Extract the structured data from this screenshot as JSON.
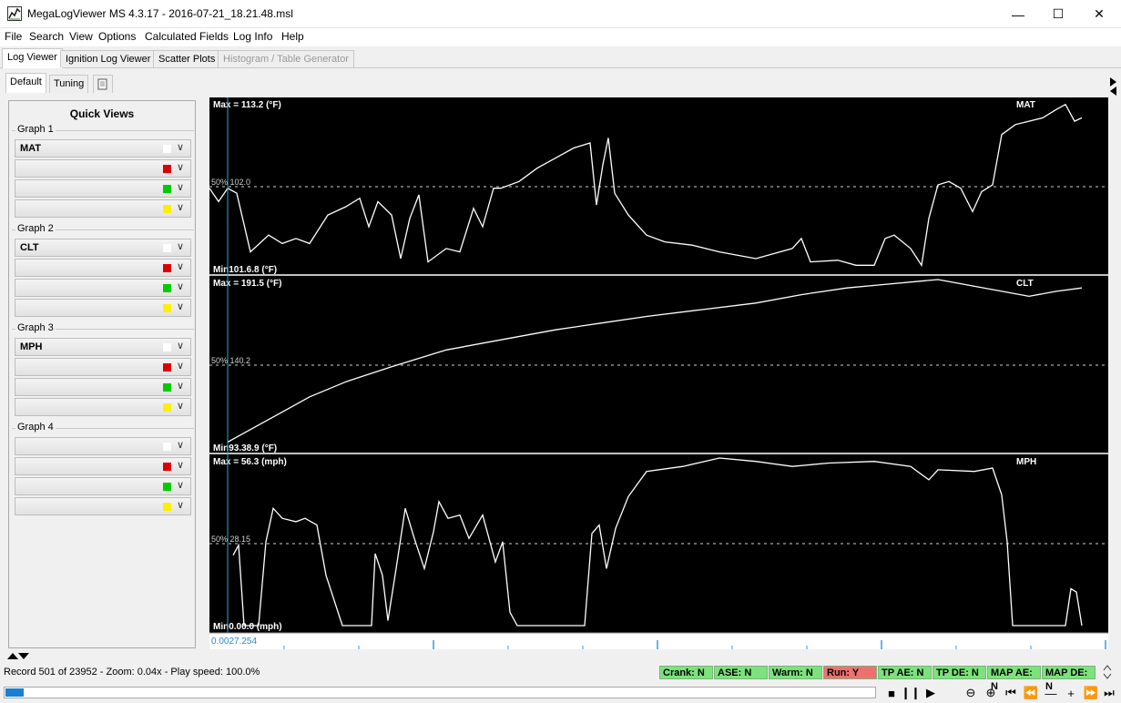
{
  "window": {
    "title": "MegaLogViewer MS 4.3.17 - 2016-07-21_18.21.48.msl"
  },
  "menu": [
    "File",
    "Search",
    "View",
    "Options",
    "Calculated Fields",
    "Log Info",
    "Help"
  ],
  "top_tabs": [
    {
      "label": "Log Viewer",
      "active": true
    },
    {
      "label": "Ignition Log Viewer"
    },
    {
      "label": "Scatter Plots"
    },
    {
      "label": "Histogram / Table Generator",
      "disabled": true
    }
  ],
  "sub_tabs": [
    {
      "label": "Default",
      "active": true
    },
    {
      "label": "Tuning"
    }
  ],
  "quick_views": {
    "title": "Quick Views",
    "groups": [
      {
        "label": "Graph 1",
        "fields": [
          "MAT",
          "",
          "",
          ""
        ]
      },
      {
        "label": "Graph 2",
        "fields": [
          "CLT",
          "",
          "",
          ""
        ]
      },
      {
        "label": "Graph 3",
        "fields": [
          "MPH",
          "",
          "",
          ""
        ]
      },
      {
        "label": "Graph 4",
        "fields": [
          "",
          "",
          "",
          ""
        ]
      }
    ],
    "swatch_colors": [
      "#ffffff",
      "#dd0000",
      "#00cc00",
      "#ffee00"
    ]
  },
  "graphs": [
    {
      "name": "MAT",
      "max_label": "Max = 113.2 (°F)",
      "min_label": "Min101.6.8 (°F)",
      "mid_label": "50%  102.0"
    },
    {
      "name": "CLT",
      "max_label": "Max = 191.5 (°F)",
      "min_label": "Min93.38.9 (°F)",
      "mid_label": "50%  140.2"
    },
    {
      "name": "MPH",
      "max_label": "Max = 56.3 (mph)",
      "min_label": "Min0.00.0 (mph)",
      "mid_label": "50%  28.15"
    }
  ],
  "cursor_label": "0.0027.254",
  "status": {
    "text": "Record 501 of 23952 - Zoom: 0.04x - Play speed: 100.0%"
  },
  "flags": [
    {
      "label": "Crank: N",
      "color": "#7ce37c"
    },
    {
      "label": "ASE: N",
      "color": "#7ce37c"
    },
    {
      "label": "Warm: N",
      "color": "#7ce37c"
    },
    {
      "label": "Run: Y",
      "color": "#f07070"
    },
    {
      "label": "TP AE: N",
      "color": "#7ce37c"
    },
    {
      "label": "TP DE: N",
      "color": "#7ce37c"
    },
    {
      "label": "MAP AE: N",
      "color": "#7ce37c"
    },
    {
      "label": "MAP DE: N",
      "color": "#7ce37c"
    }
  ],
  "progress": {
    "fraction": 0.021
  },
  "controls": [
    "stop-icon",
    "pause-icon",
    "play-icon",
    "zoom-out-icon",
    "zoom-in-icon",
    "first-icon",
    "rewind-icon",
    "minus-icon",
    "plus-icon",
    "fast-forward-icon",
    "last-icon"
  ]
}
